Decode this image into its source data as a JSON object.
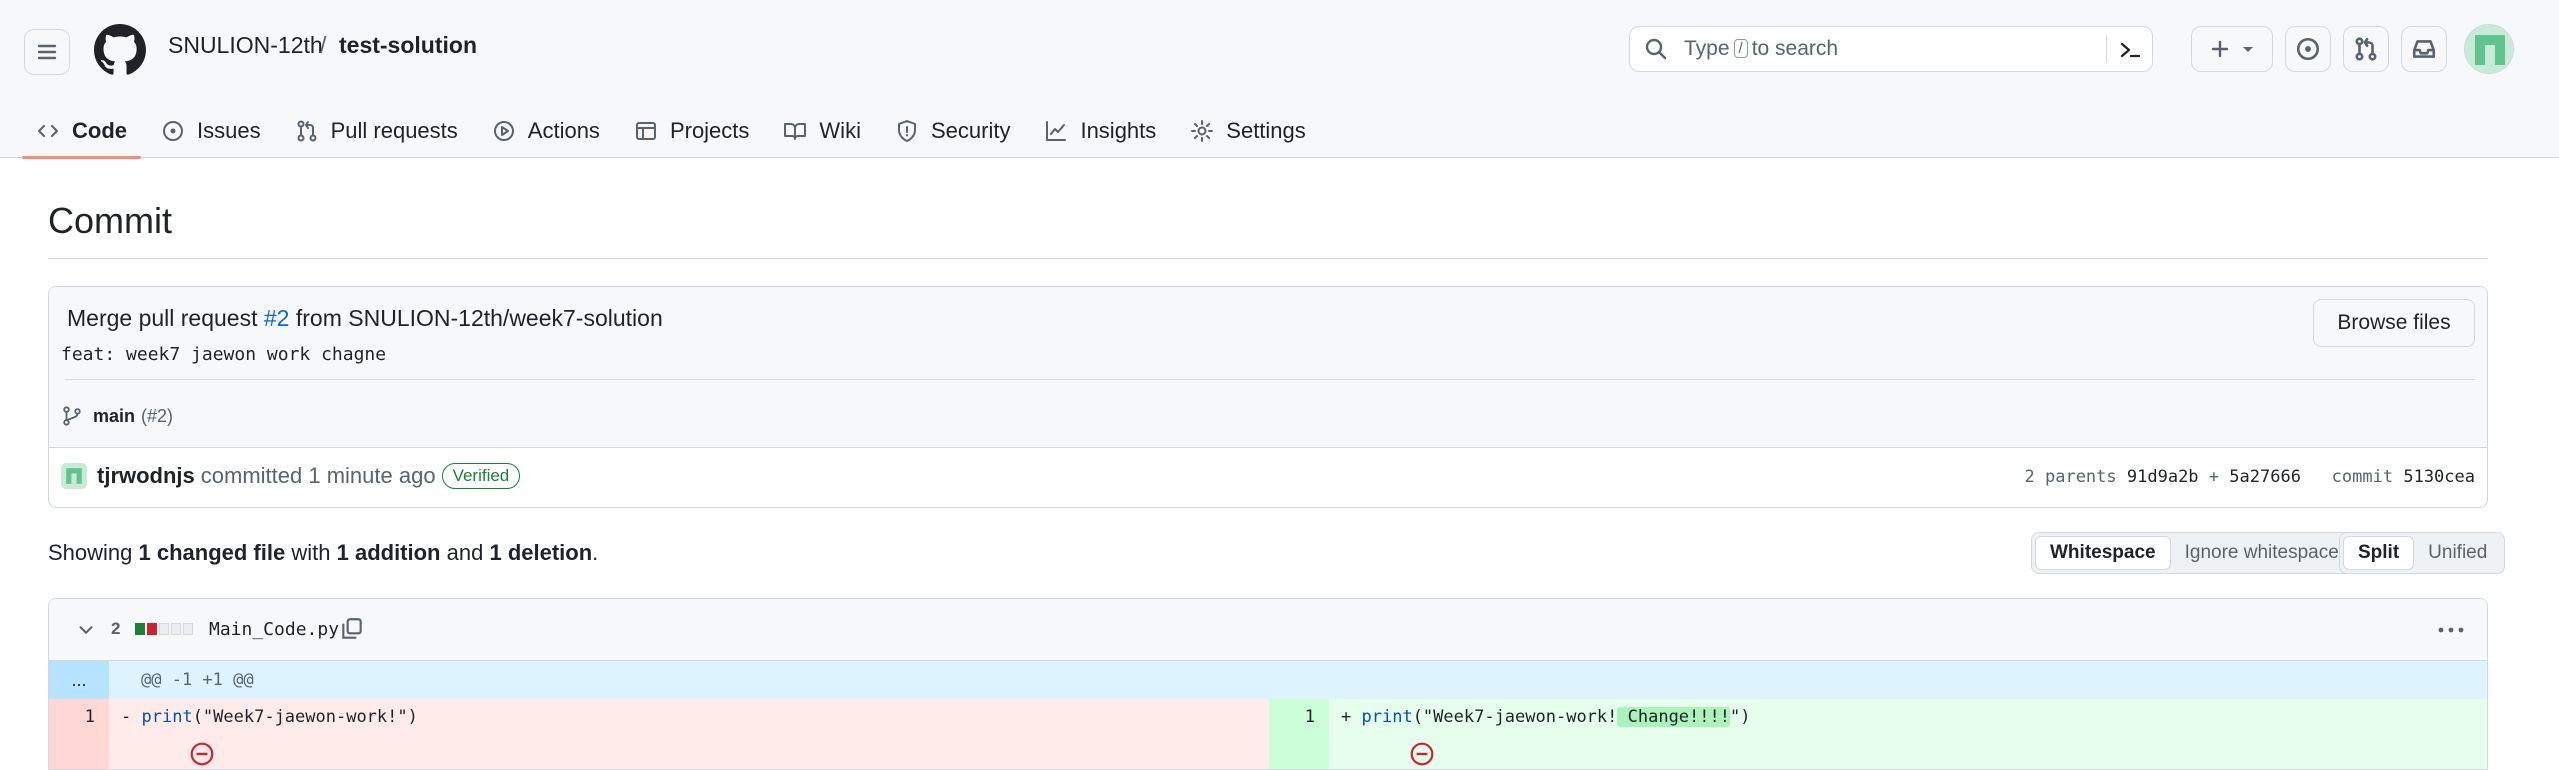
{
  "repo": {
    "owner": "SNULION-12th",
    "separator": "/",
    "name": "test-solution"
  },
  "search": {
    "prefix": "Type",
    "key": "/",
    "suffix": "to search"
  },
  "tabs": [
    {
      "label": "Code",
      "icon": "code-icon",
      "selected": true
    },
    {
      "label": "Issues",
      "icon": "issue-opened-icon"
    },
    {
      "label": "Pull requests",
      "icon": "git-pull-request-icon"
    },
    {
      "label": "Actions",
      "icon": "play-icon"
    },
    {
      "label": "Projects",
      "icon": "table-icon"
    },
    {
      "label": "Wiki",
      "icon": "book-icon"
    },
    {
      "label": "Security",
      "icon": "shield-icon"
    },
    {
      "label": "Insights",
      "icon": "graph-icon"
    },
    {
      "label": "Settings",
      "icon": "gear-icon"
    }
  ],
  "page": {
    "title": "Commit"
  },
  "commit": {
    "title_prefix": "Merge pull request",
    "pr_link": "#2",
    "title_suffix": "from SNULION-12th/week7-solution",
    "description": "feat: week7 jaewon work chagne",
    "browse_files_label": "Browse files",
    "branch": "main",
    "branch_pr": "(#2)",
    "author": "tjrwodnjs",
    "committed_text": "committed 1 minute ago",
    "verified_label": "Verified",
    "parents_label": "2 parents",
    "parent1": "91d9a2b",
    "plus": "+",
    "parent2": "5a27666",
    "commit_label": "commit",
    "sha": "5130cea"
  },
  "stats": {
    "showing": "Showing",
    "changed": "1 changed file",
    "with": "with",
    "additions": "1 addition",
    "and": "and",
    "deletions": "1 deletion",
    "period": "."
  },
  "whitespace_toggle": {
    "whitespace": "Whitespace",
    "ignore": "Ignore whitespace"
  },
  "view_toggle": {
    "split": "Split",
    "unified": "Unified"
  },
  "file": {
    "change_count": "2",
    "name": "Main_Code.py",
    "hunk_expander": "...",
    "hunk_header": "@@ -1 +1 @@",
    "left": {
      "line_no": "1",
      "marker": "-",
      "code_fn": "print",
      "code_rest": "(\"Week7-jaewon-work!\")"
    },
    "right": {
      "line_no": "1",
      "marker": "+",
      "code_fn": "print",
      "code_pre": "(\"Week7-jaewon-work!",
      "code_added": " Change!!!!",
      "code_post": "\")"
    }
  },
  "colors": {
    "accent": "#0969da",
    "deletion_bg": "#ffebe9",
    "addition_bg": "#e6ffec",
    "verified": "#1a7f37"
  }
}
